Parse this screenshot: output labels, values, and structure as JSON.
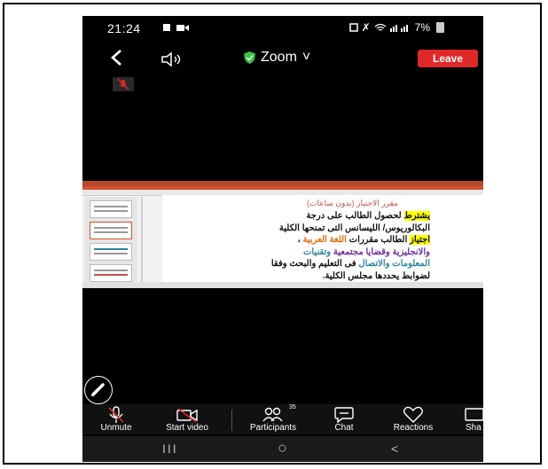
{
  "status_bar": {
    "time": "21:24",
    "battery": "7%"
  },
  "top_bar": {
    "back_icon": "chevron-left-icon",
    "speaker_icon": "speaker-icon",
    "title": "Zoom",
    "title_caret": "˅",
    "leave_label": "Leave"
  },
  "shared_slide": {
    "title": "مقرر الاجتياز (بدون ساعات)",
    "lines": [
      {
        "parts": [
          {
            "text": "يشترط",
            "style": "hl"
          },
          {
            "text": " لحصول الطالب على درجة",
            "style": ""
          }
        ]
      },
      {
        "parts": [
          {
            "text": "البكالوريوس/ الليسانس التى تمنحها الكلية",
            "style": ""
          }
        ]
      },
      {
        "parts": [
          {
            "text": "اجتياز",
            "style": "hl"
          },
          {
            "text": " الطالب مقررات ",
            "style": ""
          },
          {
            "text": "اللغة العربية",
            "style": "orange"
          },
          {
            "text": " ،",
            "style": ""
          }
        ]
      },
      {
        "parts": [
          {
            "text": "والانجليزية وقضايا مجتمعية",
            "style": "purple"
          },
          {
            "text": " وتقنيات",
            "style": "teal"
          }
        ]
      },
      {
        "parts": [
          {
            "text": "المعلومات والاتصال",
            "style": "teal"
          },
          {
            "text": " فى التعليم والبحث وفقا",
            "style": ""
          }
        ]
      },
      {
        "parts": [
          {
            "text": "لضوابط يحددها مجلس الكلية.",
            "style": ""
          }
        ]
      }
    ]
  },
  "toolbar": {
    "unmute_label": "Unmute",
    "start_video_label": "Start video",
    "participants_label": "Participants",
    "participants_count": "35",
    "chat_label": "Chat",
    "reactions_label": "Reactions",
    "share_label": "Sha"
  },
  "nav_bar": {
    "recents": "III",
    "home": "○",
    "back": "<"
  },
  "colors": {
    "leave": "#e02828",
    "shield": "#3fbf4a",
    "mute_slash": "#e02828"
  }
}
